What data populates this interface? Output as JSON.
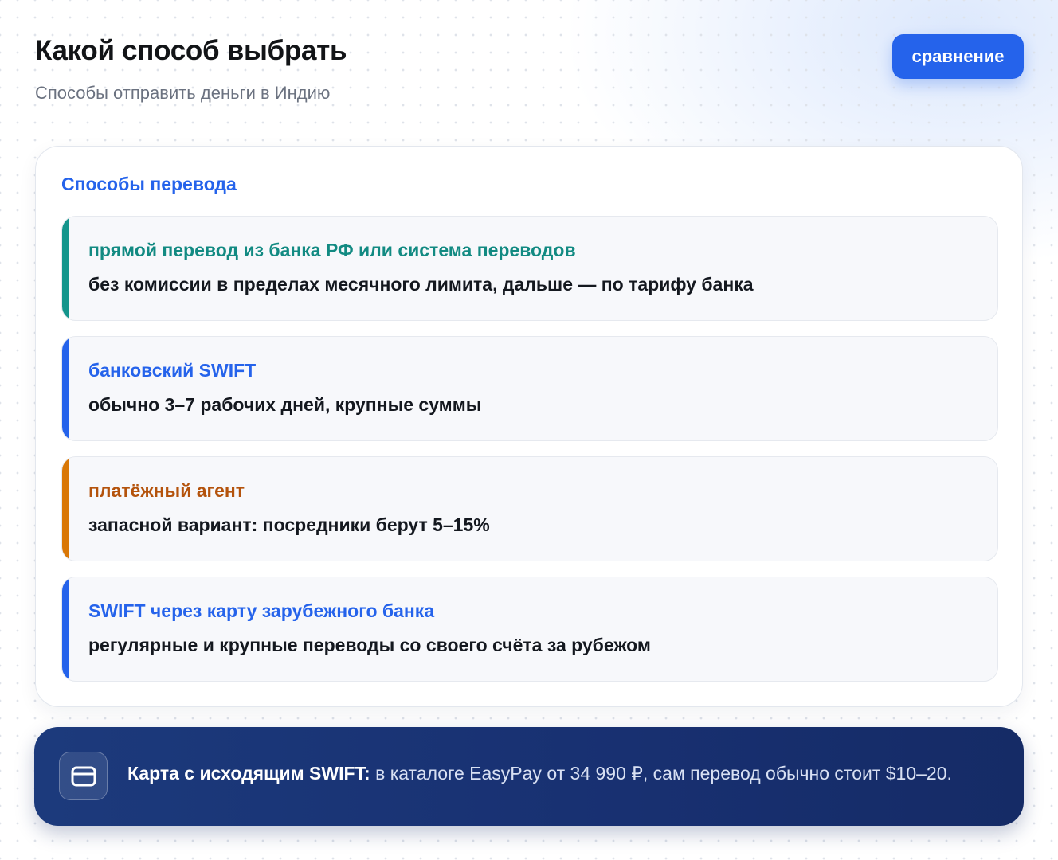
{
  "header": {
    "title": "Какой способ выбрать",
    "subtitle": "Способы отправить деньги в Индию",
    "compare_label": "сравнение"
  },
  "methods_card": {
    "title": "Способы перевода",
    "items": [
      {
        "title": "прямой перевод из банка РФ или система переводов",
        "description": "без комиссии в пределах месячного лимита, дальше — по тарифу банка",
        "accent_color": "#14958c",
        "title_color": "#128a82"
      },
      {
        "title": "банковский SWIFT",
        "description": "обычно 3–7 рабочих дней, крупные суммы",
        "accent_color": "#2563eb",
        "title_color": "#2563eb"
      },
      {
        "title": "платёжный агент",
        "description": "запасной вариант: посредники берут 5–15%",
        "accent_color": "#d97706",
        "title_color": "#b4530c"
      },
      {
        "title": "SWIFT через карту зарубежного банка",
        "description": "регулярные и крупные переводы со своего счёта за рубежом",
        "accent_color": "#2563eb",
        "title_color": "#2563eb"
      }
    ]
  },
  "banner": {
    "icon": "credit-card-icon",
    "strong": "Карта с исходящим SWIFT:",
    "text": " в каталоге EasyPay от 34 990 ₽, сам перевод обычно стоит $10–20."
  },
  "colors": {
    "primary": "#2563eb",
    "banner_bg": "#1a3475"
  }
}
